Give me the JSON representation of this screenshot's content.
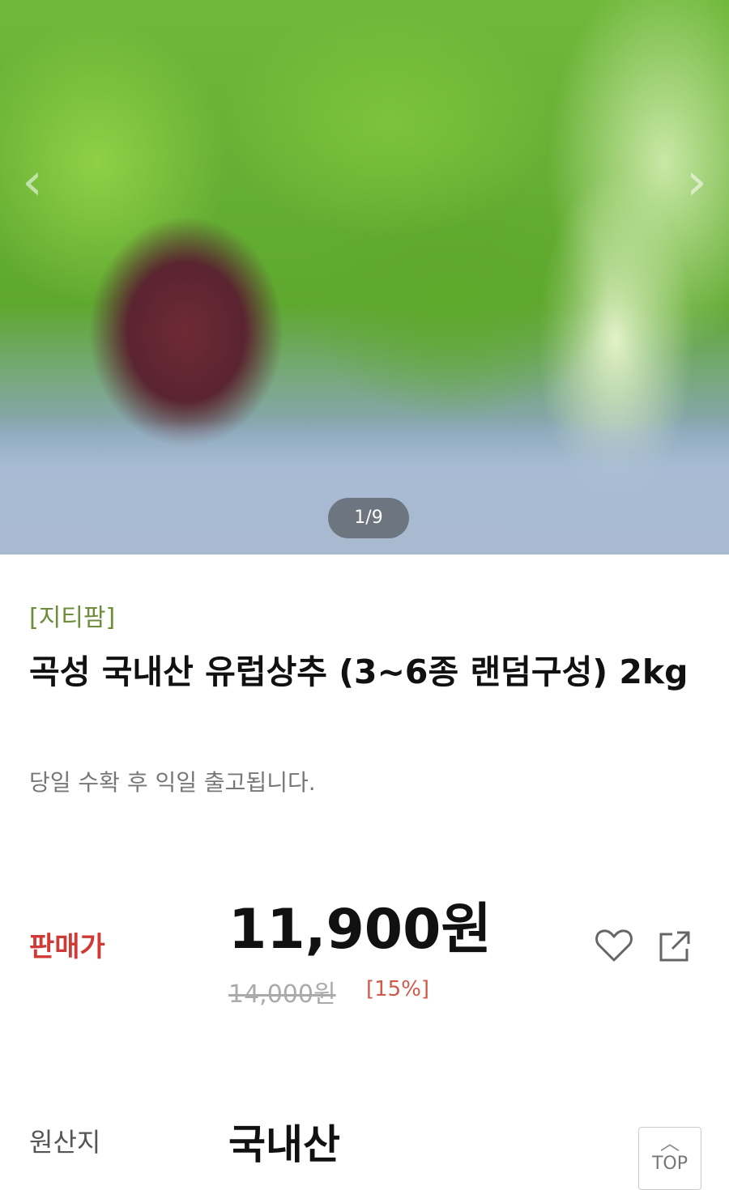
{
  "gallery": {
    "counter": "1/9",
    "prev_icon": "chevron-left-icon",
    "next_icon": "chevron-right-icon"
  },
  "product": {
    "brand": "[지티팜]",
    "title": "곡성 국내산 유럽상추 (3~6종 랜덤구성) 2kg",
    "subtitle": "당일 수확 후 익일 출고됩니다."
  },
  "price": {
    "label": "판매가",
    "sale": "11,900원",
    "original": "14,000원",
    "discount": "[15%]",
    "label_color": "#d03a36"
  },
  "actions": {
    "wishlist_icon": "heart-icon",
    "share_icon": "share-icon"
  },
  "origin": {
    "label": "원산지",
    "value": "국내산"
  },
  "top_button": {
    "label": "TOP",
    "icon": "chevron-up-icon"
  }
}
